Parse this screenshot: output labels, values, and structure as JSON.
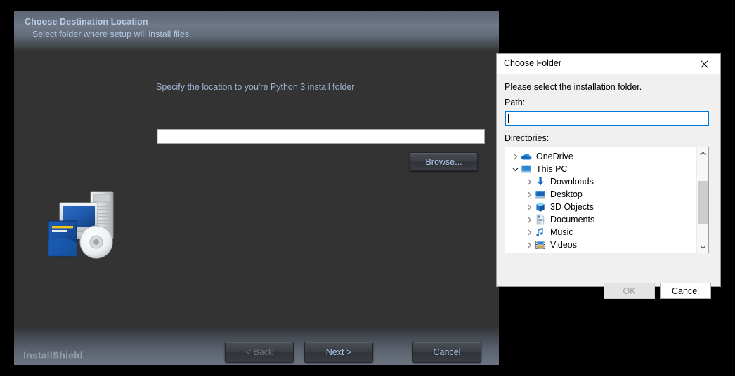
{
  "installer": {
    "header": {
      "title": "Choose Destination Location",
      "subtitle": "Select folder where setup will install files."
    },
    "instruction": "Specify the location to you're Python 3 install folder",
    "path_input_value": "",
    "browse_button": "Browse...",
    "product_icon": "installshield-setup-icon",
    "footer": {
      "logo": "InstallShield",
      "back_button": "< Back",
      "next_button": "Next >",
      "cancel_button": "Cancel"
    },
    "colors": {
      "body_bg": "#333333",
      "header_accent": "#6e7886",
      "link_text": "#aac3e4"
    }
  },
  "folder_dialog": {
    "title": "Choose Folder",
    "close_icon": "close-icon",
    "instruction": "Please select the installation folder.",
    "path_label": "Path:",
    "path_value": "",
    "directories_label": "Directories:",
    "tree": [
      {
        "label": "OneDrive",
        "icon": "cloud-icon",
        "expanded": false,
        "level": 0
      },
      {
        "label": "This PC",
        "icon": "monitor-icon",
        "expanded": true,
        "level": 0
      },
      {
        "label": "Downloads",
        "icon": "download-icon",
        "expanded": false,
        "level": 1
      },
      {
        "label": "Desktop",
        "icon": "desktop-icon",
        "expanded": false,
        "level": 1
      },
      {
        "label": "3D Objects",
        "icon": "cube-icon",
        "expanded": false,
        "level": 1
      },
      {
        "label": "Documents",
        "icon": "document-icon",
        "expanded": false,
        "level": 1
      },
      {
        "label": "Music",
        "icon": "music-note-icon",
        "expanded": false,
        "level": 1
      },
      {
        "label": "Videos",
        "icon": "film-icon",
        "expanded": false,
        "level": 1
      }
    ],
    "ok_button": "OK",
    "ok_enabled": false,
    "cancel_button": "Cancel",
    "accent_color": "#0078d7"
  }
}
